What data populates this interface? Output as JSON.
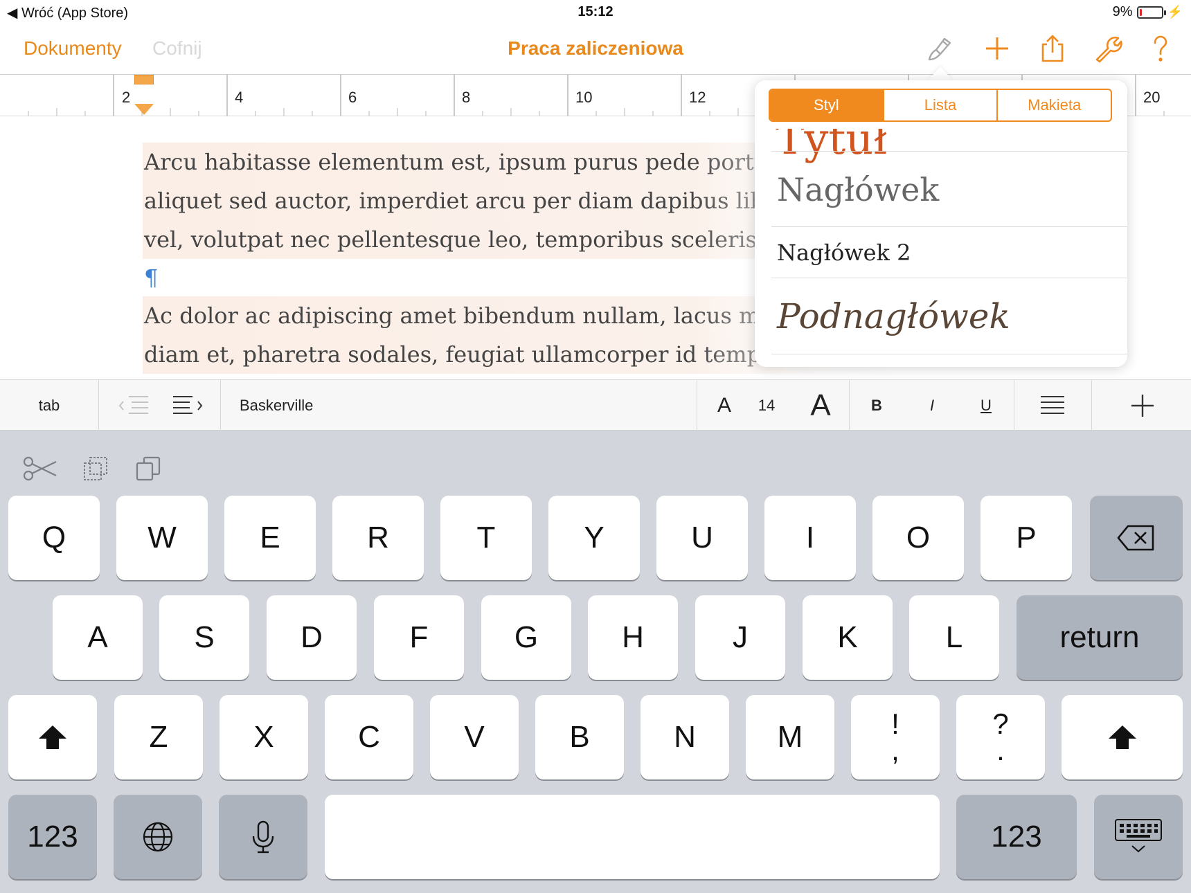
{
  "status_bar": {
    "back_label": "Wróć (App Store)",
    "time": "15:12",
    "battery_percent": "9%",
    "battery_level": 0.09
  },
  "nav": {
    "documents_label": "Dokumenty",
    "undo_label": "Cofnij",
    "title": "Praca zaliczeniowa",
    "icons": [
      "paintbrush-icon",
      "plus-icon",
      "share-icon",
      "wrench-icon",
      "help-icon"
    ]
  },
  "ruler": {
    "labels": [
      "2",
      "4",
      "6",
      "8",
      "10",
      "12",
      "20"
    ]
  },
  "document": {
    "lines": [
      "Arcu habitasse elementum est, ipsum purus pede portt",
      "aliquet sed auctor, imperdiet arcu per diam dapibus lib",
      "vel, volutpat nec pellentesque leo, temporibus scelerisq",
      "Ac dolor ac adipiscing amet bibendum nullam, lacus m",
      "diam et, pharetra sodales, feugiat ullamcorper id tempo"
    ],
    "pilcrow": "¶"
  },
  "popover": {
    "tabs": [
      "Styl",
      "Lista",
      "Makieta"
    ],
    "active_tab": "Styl",
    "styles": [
      "Nagłówek",
      "Nagłówek 2",
      "Podnagłówek"
    ],
    "accent": "#f08a1e"
  },
  "format_bar": {
    "tab_label": "tab",
    "font_name": "Baskerville",
    "font_size": "14",
    "size_small_label": "A",
    "size_large_label": "A",
    "bold_label": "B",
    "italic_label": "I",
    "underline_label": "U"
  },
  "keyboard": {
    "row1": [
      "Q",
      "W",
      "E",
      "R",
      "T",
      "Y",
      "U",
      "I",
      "O",
      "P"
    ],
    "row2": [
      "A",
      "S",
      "D",
      "F",
      "G",
      "H",
      "J",
      "K",
      "L"
    ],
    "row3": [
      "Z",
      "X",
      "C",
      "V",
      "B",
      "N",
      "M"
    ],
    "punct1": [
      "!",
      ","
    ],
    "punct2": [
      "?",
      "."
    ],
    "return_label": "return",
    "numbers_label": "123"
  }
}
